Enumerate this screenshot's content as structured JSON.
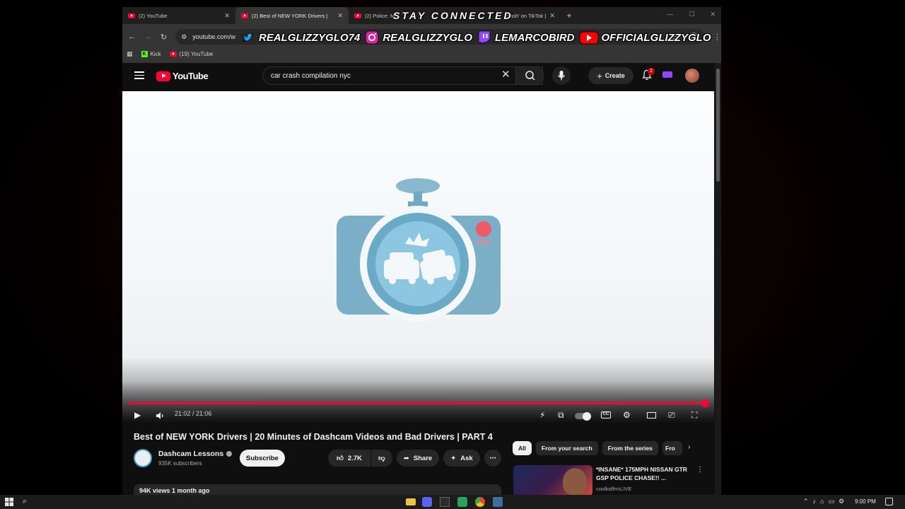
{
  "browser": {
    "tabs": [
      {
        "label": "(2) YouTube"
      },
      {
        "label": "(2) Best of NEW YORK Drivers |"
      },
      {
        "label": "(2) Police: M"
      },
      {
        "label": "crash' on TikTok |"
      }
    ],
    "address": "youtube.com/w",
    "bookmarks": [
      {
        "label": "Kick"
      },
      {
        "label": "(19) YouTube"
      }
    ]
  },
  "youtube": {
    "logo": "YouTube",
    "search_value": "car crash compilation nyc",
    "create_label": "Create",
    "notifications_count": "2",
    "player": {
      "time": "21:02 / 21:06",
      "progress": 0.997
    },
    "video_title": "Best of NEW YORK Drivers | 20 Minutes of Dashcam Videos and Bad Drivers | PART 4",
    "channel": {
      "name": "Dashcam Lessons",
      "subscribers": "935K subscribers",
      "subscribe_label": "Subscribe"
    },
    "actions": {
      "likes": "2.7K",
      "share": "Share",
      "ask": "Ask"
    },
    "description_meta": "94K views  1 month ago",
    "chips": [
      {
        "label": "All",
        "active": true
      },
      {
        "label": "From your search",
        "active": false
      },
      {
        "label": "From the series",
        "active": false
      },
      {
        "label": "Fro",
        "active": false
      }
    ],
    "recommendation": {
      "title": "*INSANE* 175MPH NISSAN GTR GSP POLICE CHASE!! ...",
      "channel": "coolkidfrmLIVE"
    }
  },
  "overlay": {
    "title": "STAY CONNECTED",
    "socials": [
      {
        "platform": "twitter",
        "handle": "REALGLIZZYGLO74"
      },
      {
        "platform": "instagram",
        "handle": "REALGLIZZYGLO"
      },
      {
        "platform": "twitch",
        "handle": "LEMARCOBIRD"
      },
      {
        "platform": "youtube",
        "handle": "OFFICIALGLIZZYGLO"
      }
    ]
  },
  "taskbar": {
    "clock": "9:00 PM"
  },
  "colors": {
    "youtube_red": "#ff0033",
    "dashcam_blue": "#6fa8c4",
    "dark_bg": "#0f0f0f"
  }
}
